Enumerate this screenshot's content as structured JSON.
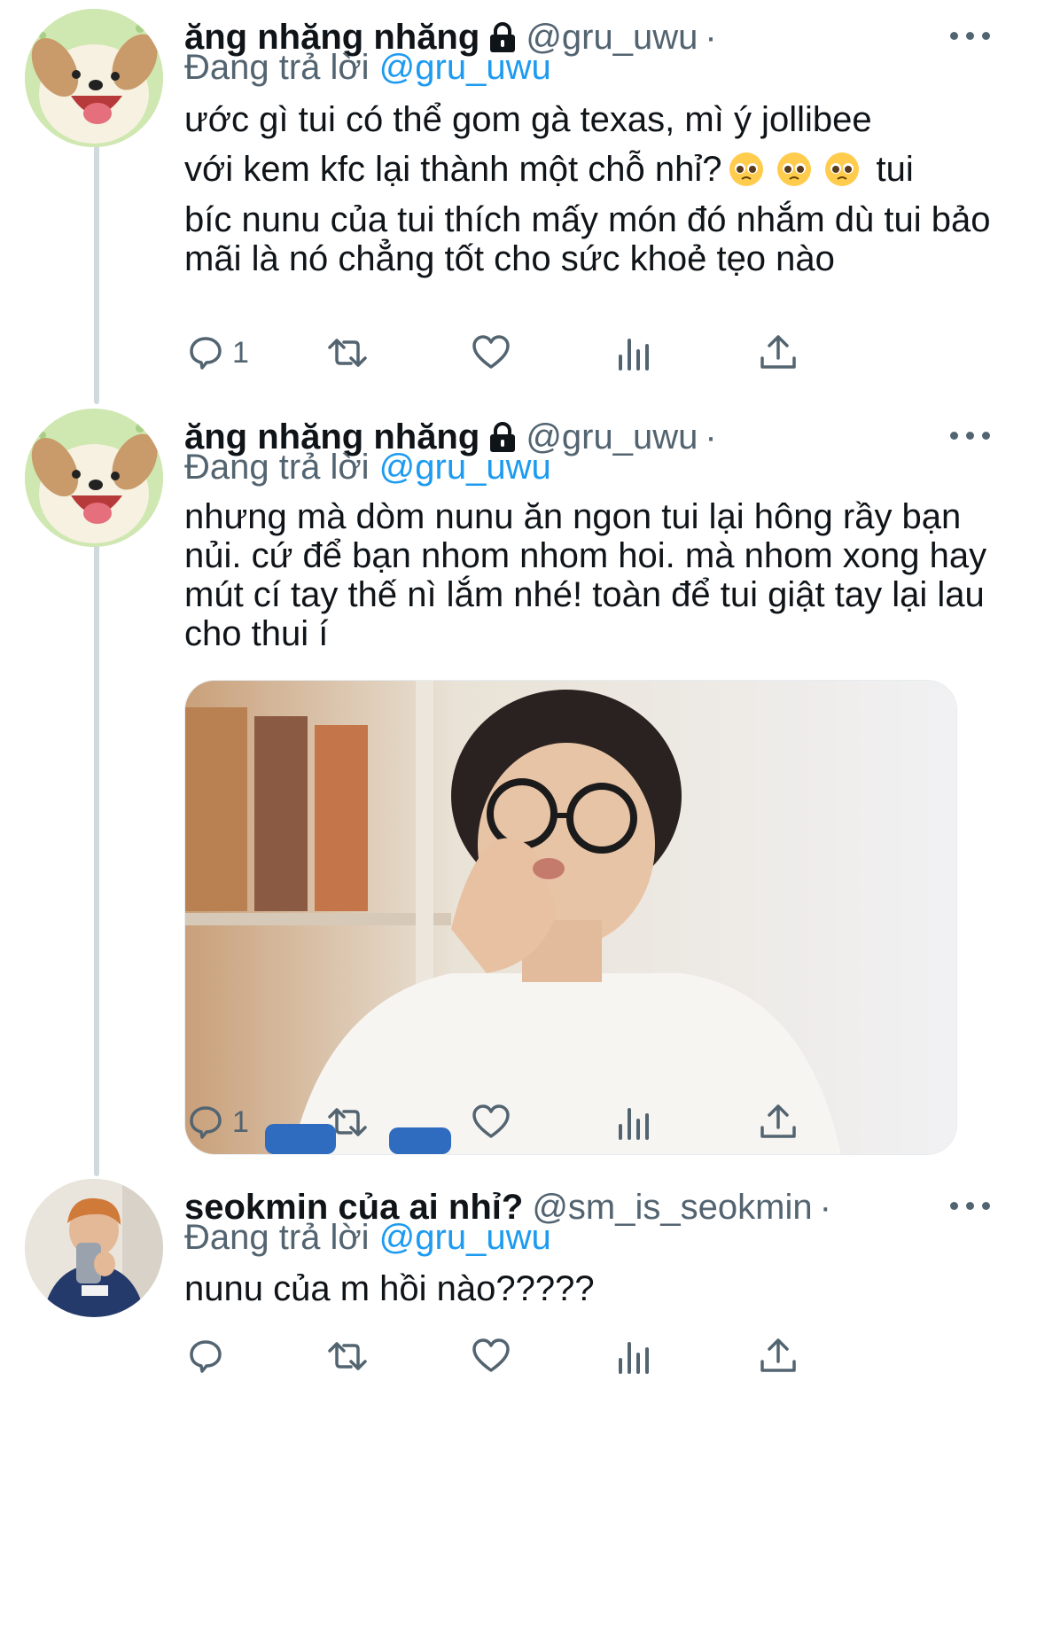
{
  "tweets": [
    {
      "display_name": "ăng nhăng nhăng",
      "handle": "@gru_uwu",
      "separator": "·",
      "replying_prefix": "Đang trả lời",
      "replying_to": "@gru_uwu",
      "text_line1": "ước gì tui có thể gom gà texas, mì ý jollibee",
      "text_line2a": "với kem kfc lại thành một chỗ nhỉ?",
      "text_line2b": "tui",
      "text_rest": "bíc nunu của tui thích mấy món đó nhắm dù tui bảo mãi là nó chẳng tốt cho sức khoẻ tẹo nào",
      "reply_count": "1",
      "locked": true,
      "avatar_icon": "puppy-avatar"
    },
    {
      "display_name": "ăng nhăng nhăng",
      "handle": "@gru_uwu",
      "separator": "·",
      "replying_prefix": "Đang trả lời",
      "replying_to": "@gru_uwu",
      "text": "nhưng mà dòm nunu ăn ngon tui lại hông rầy bạn nủi. cứ để bạn nhom nhom hoi. mà nhom xong hay mút cí tay thế nì lắm nhé! toàn để tui giật tay lại lau cho thui í",
      "reply_count": "1",
      "locked": true,
      "avatar_icon": "puppy-avatar",
      "media_icon": "photo-man-with-glasses-licking-fingers"
    },
    {
      "display_name": "seokmin của ai nhỉ?",
      "handle": "@sm_is_seokmin",
      "separator": "·",
      "replying_prefix": "Đang trả lời",
      "replying_to": "@gru_uwu",
      "text": "nunu của m hồi nào?????",
      "reply_count": "",
      "locked": false,
      "avatar_icon": "mirror-selfie-avatar"
    }
  ],
  "icons": {
    "reply": "reply-icon",
    "retweet": "retweet-icon",
    "like": "like-icon",
    "views": "views-icon",
    "share": "share-icon",
    "more": "more-icon",
    "lock": "lock-icon",
    "emoji": "pleading-face-emoji"
  },
  "colors": {
    "link": "#1d9bf0",
    "secondary": "#536471",
    "thread_line": "#cfd9de"
  }
}
